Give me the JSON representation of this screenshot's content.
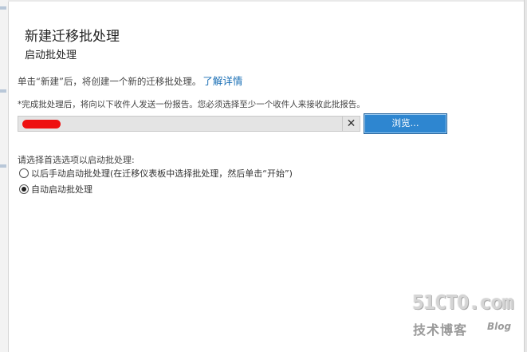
{
  "dialog": {
    "title": "新建迁移批处理",
    "subtitle": "启动批处理",
    "intro_text": "单击“新建”后，将创建一个新的迁移批处理。",
    "learn_more_link": "了解详情"
  },
  "report": {
    "label": "*完成批处理后，将向以下收件人发送一份报告。您必须选择至少一个收件人来接收此批报告。",
    "clear_icon_glyph": "✕",
    "browse_label": "浏览..."
  },
  "start_options": {
    "label": "请选择首选选项以启动批处理:",
    "options": [
      {
        "label": "以后手动启动批处理(在迁移仪表板中选择批处理，然后单击“开始”)",
        "checked": false
      },
      {
        "label": "自动启动批处理",
        "checked": true
      }
    ]
  },
  "watermark": {
    "brand": "51CTO.com",
    "sub": "技术博客",
    "blog": "Blog"
  },
  "colors": {
    "accent": "#2e86d0",
    "link": "#1a6fb5",
    "redaction": "#ee1111"
  }
}
